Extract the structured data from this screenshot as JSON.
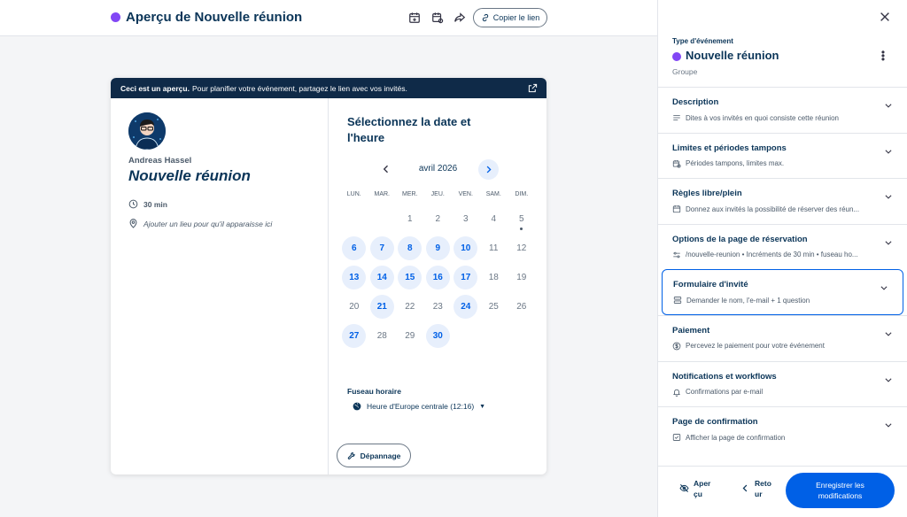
{
  "topbar": {
    "title": "Aperçu de Nouvelle réunion",
    "accent_color": "#8247f5",
    "icons": [
      "calendar-add-icon",
      "calendar-settings-icon",
      "share-icon"
    ],
    "copy_link_label": "Copier le lien"
  },
  "preview": {
    "banner_bold": "Ceci est un aperçu.",
    "banner_text": "Pour planifier votre événement, partagez le lien avec vos invités.",
    "host_name": "Andreas Hassel",
    "event_name": "Nouvelle réunion",
    "duration": "30 min",
    "location_hint": "Ajouter un lieu pour qu'il apparaisse ici",
    "select_title": "Sélectionnez la date et l'heure",
    "month": "avril 2026",
    "weekdays": [
      "LUN.",
      "MAR.",
      "MER.",
      "JEU.",
      "VEN.",
      "SAM.",
      "DIM."
    ],
    "days": [
      {
        "d": "",
        "a": false
      },
      {
        "d": "",
        "a": false
      },
      {
        "d": "1",
        "a": false
      },
      {
        "d": "2",
        "a": false
      },
      {
        "d": "3",
        "a": false
      },
      {
        "d": "4",
        "a": false
      },
      {
        "d": "5",
        "a": false,
        "today": true
      },
      {
        "d": "6",
        "a": true
      },
      {
        "d": "7",
        "a": true
      },
      {
        "d": "8",
        "a": true
      },
      {
        "d": "9",
        "a": true
      },
      {
        "d": "10",
        "a": true
      },
      {
        "d": "11",
        "a": false
      },
      {
        "d": "12",
        "a": false
      },
      {
        "d": "13",
        "a": true
      },
      {
        "d": "14",
        "a": true
      },
      {
        "d": "15",
        "a": true
      },
      {
        "d": "16",
        "a": true
      },
      {
        "d": "17",
        "a": true
      },
      {
        "d": "18",
        "a": false
      },
      {
        "d": "19",
        "a": false
      },
      {
        "d": "20",
        "a": false
      },
      {
        "d": "21",
        "a": true
      },
      {
        "d": "22",
        "a": false
      },
      {
        "d": "23",
        "a": false
      },
      {
        "d": "24",
        "a": true
      },
      {
        "d": "25",
        "a": false
      },
      {
        "d": "26",
        "a": false
      },
      {
        "d": "27",
        "a": true
      },
      {
        "d": "28",
        "a": false
      },
      {
        "d": "29",
        "a": false
      },
      {
        "d": "30",
        "a": true
      }
    ],
    "timezone_label": "Fuseau horaire",
    "timezone_value": "Heure d'Europe centrale (12:16)",
    "troubleshoot_label": "Dépannage"
  },
  "panel": {
    "type_label": "Type d'événement",
    "event_name": "Nouvelle réunion",
    "event_kind": "Groupe",
    "sections": [
      {
        "title": "Description",
        "sub": "Dites à vos invités en quoi consiste cette réunion",
        "icon": "text-lines-icon"
      },
      {
        "title": "Limites et périodes tampons",
        "sub": "Périodes tampons, limites max.",
        "icon": "calendar-clock-icon"
      },
      {
        "title": "Règles libre/plein",
        "sub": "Donnez aux invités la possibilité de réserver des réun...",
        "icon": "calendar-icon"
      },
      {
        "title": "Options de la page de réservation",
        "sub": "/nouvelle-reunion • Incréments de 30 min • fuseau ho...",
        "icon": "sliders-icon"
      },
      {
        "title": "Formulaire d'invité",
        "sub": "Demander le nom, l'e-mail + 1 question",
        "icon": "form-icon",
        "active": true
      },
      {
        "title": "Paiement",
        "sub": "Percevez le paiement pour votre événement",
        "icon": "dollar-icon"
      },
      {
        "title": "Notifications et workflows",
        "sub": "Confirmations par e-mail",
        "icon": "bell-icon"
      },
      {
        "title": "Page de confirmation",
        "sub": "Afficher la page de confirmation",
        "icon": "confirm-page-icon"
      }
    ],
    "footer": {
      "preview_label": "Aperçu",
      "back_label": "Retour",
      "save_label": "Enregistrer les modifications"
    }
  }
}
